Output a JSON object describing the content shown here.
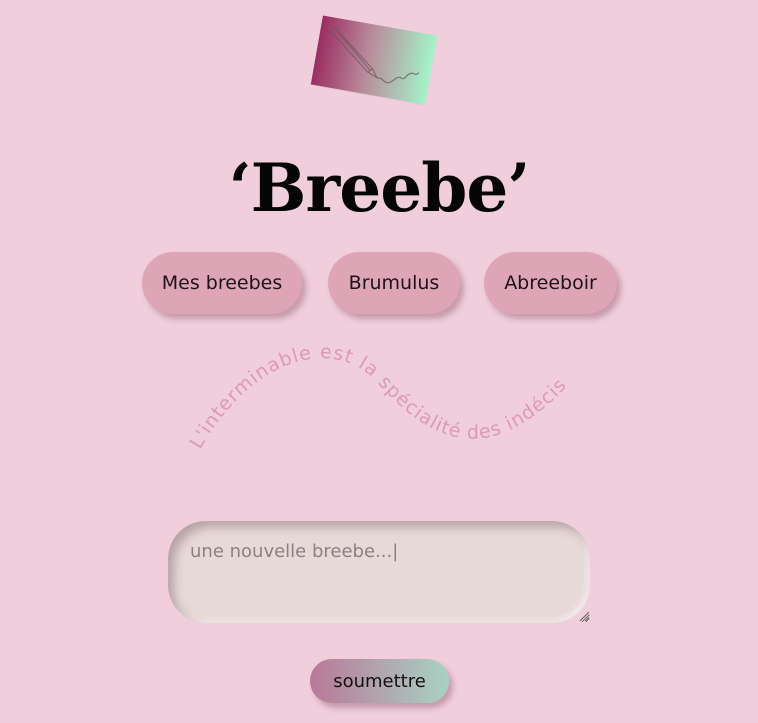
{
  "logo": {
    "icon": "pencil-drawing-icon",
    "gradient": [
      "#9b2d62",
      "#a2f5c8"
    ]
  },
  "title": "‘Breebe’",
  "nav": {
    "mes_breebes": "Mes breebes",
    "brumulus": "Brumulus",
    "abreeboir": "Abreeboir"
  },
  "tagline": "L'interminable est la spécialité des indécis",
  "compose": {
    "placeholder": "une nouvelle breebe...|"
  },
  "submit_label": "soumettre",
  "colors": {
    "background": "#f0cedc",
    "button": "#dea5b7",
    "tagline": "#dc9bb3",
    "textarea": "#e8d9d9"
  }
}
